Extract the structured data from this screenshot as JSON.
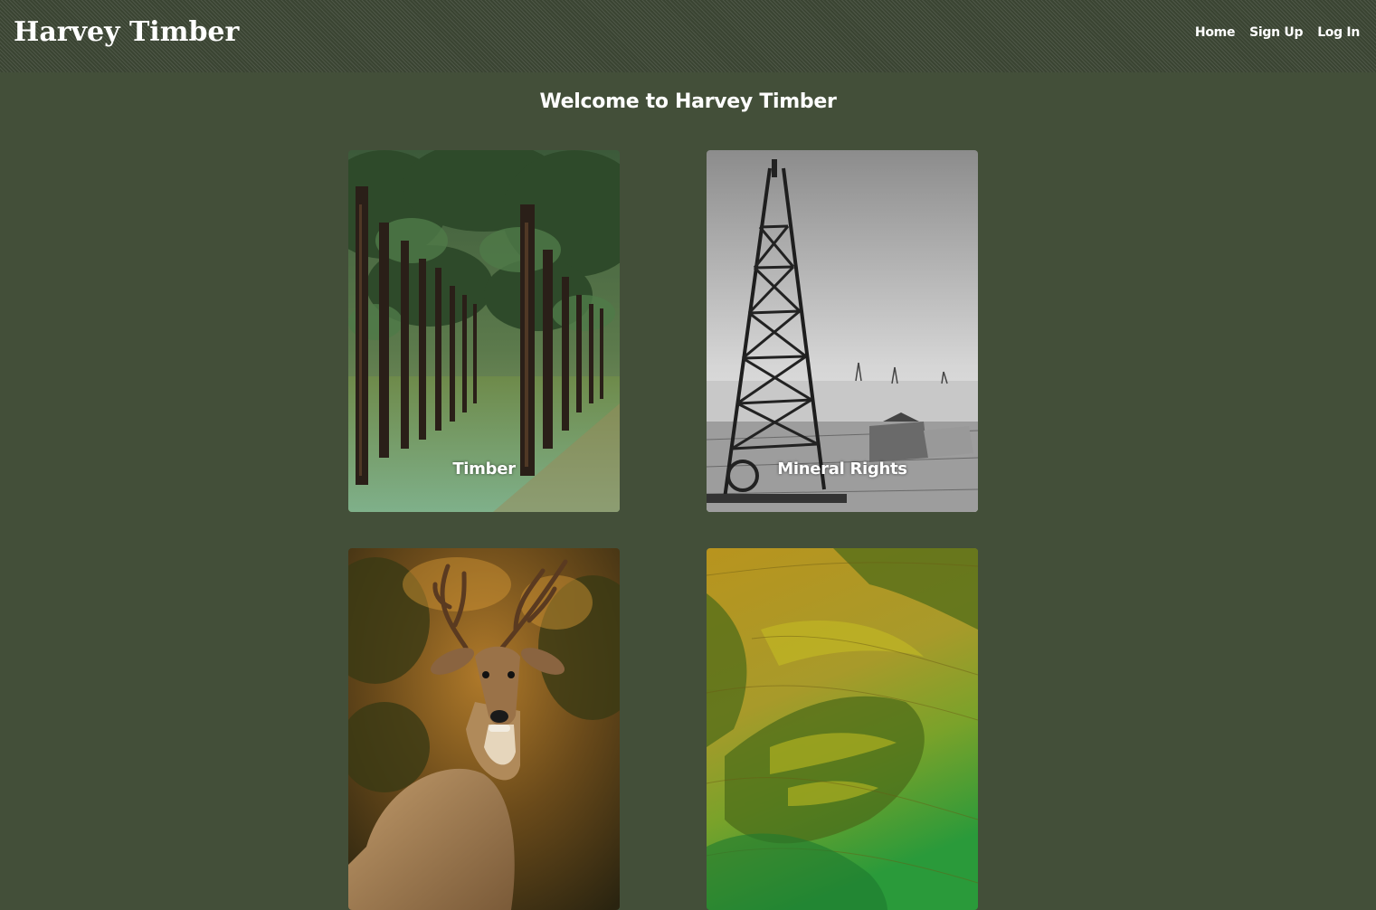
{
  "header": {
    "brand": "Harvey Timber",
    "nav": [
      {
        "label": "Home"
      },
      {
        "label": "Sign Up"
      },
      {
        "label": "Log In"
      }
    ]
  },
  "main": {
    "title": "Welcome to Harvey Timber",
    "cards": [
      {
        "label": "Timber",
        "image": "pine-forest-photo"
      },
      {
        "label": "Mineral Rights",
        "image": "oil-derrick-photo"
      },
      {
        "label": "",
        "image": "whitetail-deer-photo"
      },
      {
        "label": "",
        "image": "lidar-terrain-photo"
      }
    ]
  },
  "colors": {
    "background": "#434f39",
    "navbar": "#3a4432",
    "text": "#ffffff"
  }
}
